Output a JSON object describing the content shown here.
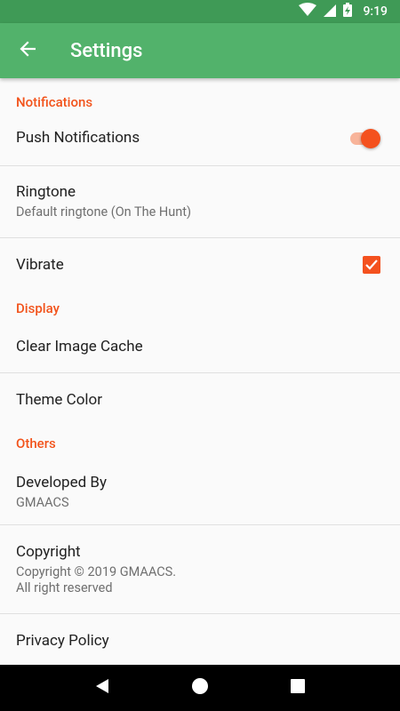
{
  "status_bar": {
    "time": "9:19"
  },
  "app_bar": {
    "title": "Settings"
  },
  "sections": {
    "notifications": "Notifications",
    "display": "Display",
    "others": "Others"
  },
  "prefs": {
    "push": {
      "title": "Push Notifications",
      "enabled": true
    },
    "ringtone": {
      "title": "Ringtone",
      "summary": "Default ringtone (On The Hunt)"
    },
    "vibrate": {
      "title": "Vibrate",
      "checked": true
    },
    "clear_cache": {
      "title": "Clear Image Cache"
    },
    "theme_color": {
      "title": "Theme Color"
    },
    "developed_by": {
      "title": "Developed By",
      "summary": "GMAACS"
    },
    "copyright": {
      "title": "Copyright",
      "summary": "Copyright © 2019 GMAACS.\nAll right reserved"
    },
    "privacy": {
      "title": "Privacy Policy"
    }
  },
  "colors": {
    "status_bar": "#3f9a56",
    "app_bar": "#52b26b",
    "accent": "#f4511e"
  },
  "icons": {
    "back": "arrow-back-icon",
    "wifi": "wifi-icon",
    "signal": "signal-icon",
    "battery": "battery-charging-icon",
    "nav_back": "nav-back-icon",
    "nav_home": "nav-home-icon",
    "nav_recents": "nav-recents-icon"
  }
}
